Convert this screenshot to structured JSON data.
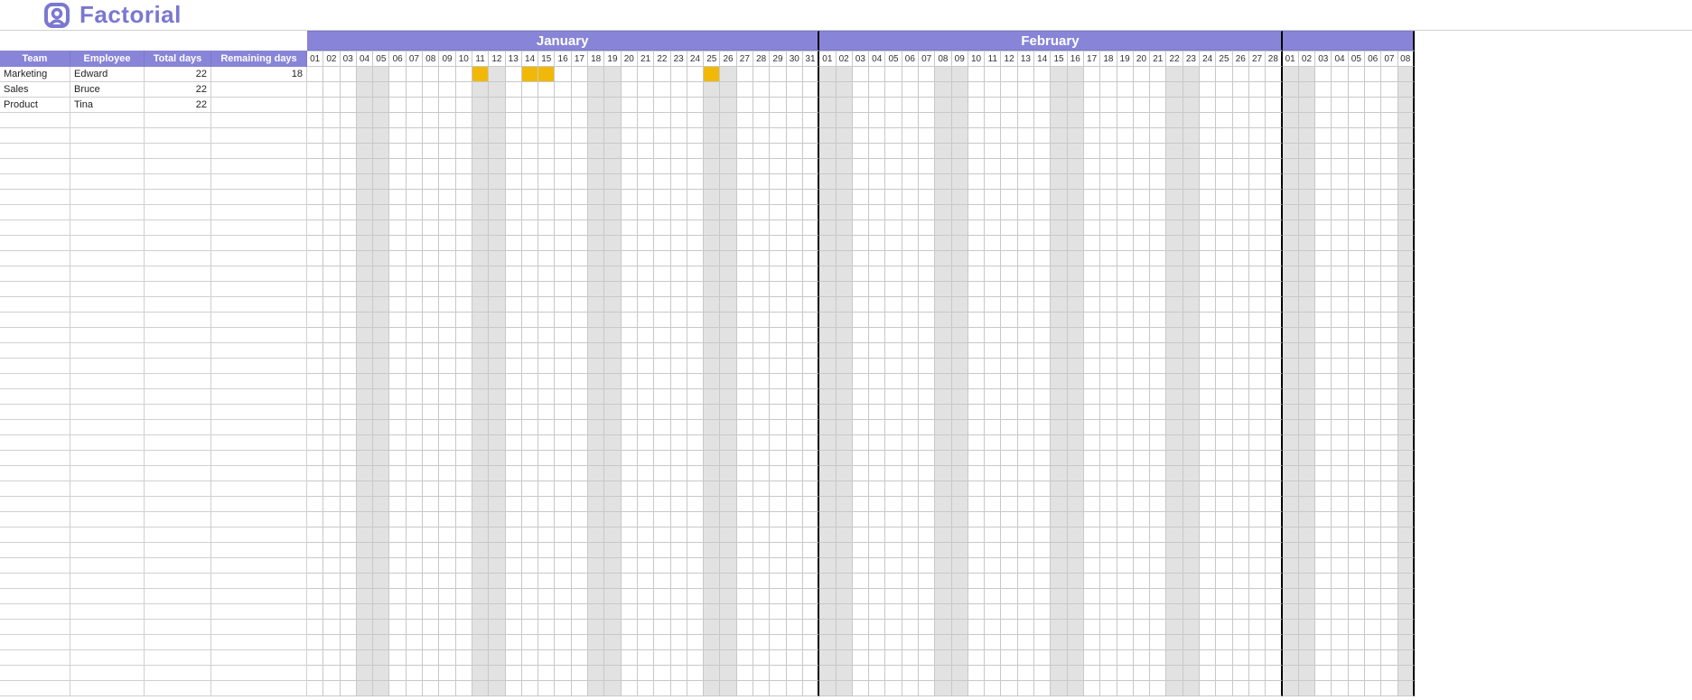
{
  "brand": {
    "name": "Factorial"
  },
  "headers": {
    "team": "Team",
    "employee": "Employee",
    "total": "Total days",
    "remaining": "Remaining days"
  },
  "months": [
    {
      "name": "January",
      "days": 31,
      "weekend_days": [
        4,
        5,
        11,
        12,
        18,
        19,
        25,
        26
      ]
    },
    {
      "name": "February",
      "days": 28,
      "weekend_days": [
        1,
        2,
        8,
        9,
        15,
        16,
        22,
        23
      ]
    },
    {
      "name": "",
      "days": 8,
      "weekend_days": [
        1,
        2,
        8
      ]
    }
  ],
  "employees": [
    {
      "team": "Marketing",
      "name": "Edward",
      "total": 22,
      "remaining": 18,
      "holidays": {
        "0": [
          11,
          14,
          15,
          25
        ]
      }
    },
    {
      "team": "Sales",
      "name": "Bruce",
      "total": 22,
      "remaining": "",
      "holidays": {}
    },
    {
      "team": "Product",
      "name": "Tina",
      "total": 22,
      "remaining": "",
      "holidays": {}
    }
  ],
  "empty_rows": 38
}
